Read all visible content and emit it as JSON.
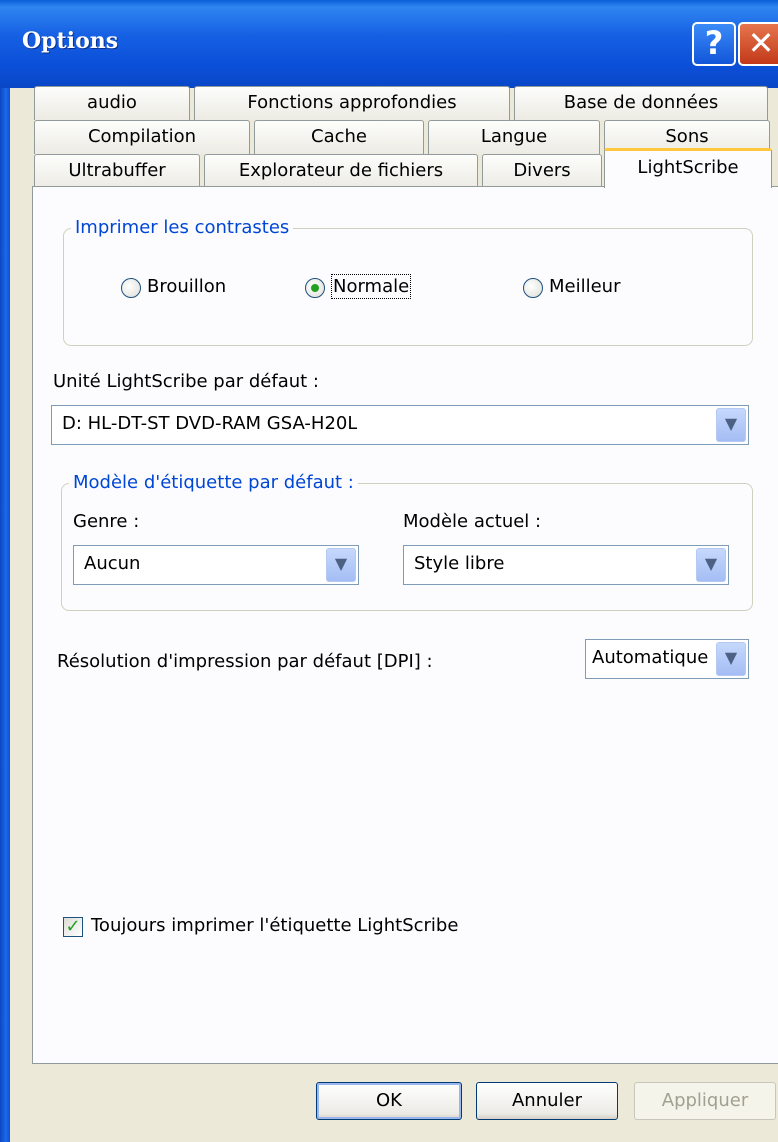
{
  "window": {
    "title": "Options"
  },
  "tabs": {
    "row1": [
      "audio",
      "Fonctions approfondies",
      "Base de données"
    ],
    "row2": [
      "Compilation",
      "Cache",
      "Langue",
      "Sons"
    ],
    "row3": [
      "Ultrabuffer",
      "Explorateur de fichiers",
      "Divers",
      "LightScribe"
    ],
    "active": "LightScribe"
  },
  "print_contrast": {
    "title": "Imprimer les contrastes",
    "options": [
      "Brouillon",
      "Normale",
      "Meilleur"
    ],
    "selected": "Normale"
  },
  "default_drive": {
    "label": "Unité LightScribe par défaut :",
    "value": "D: HL-DT-ST DVD-RAM GSA-H20L"
  },
  "label_template": {
    "title": "Modèle d'étiquette par défaut :",
    "genre_label": "Genre :",
    "genre_value": "Aucun",
    "model_label": "Modèle actuel :",
    "model_value": "Style libre"
  },
  "resolution": {
    "label": "Résolution d'impression par défaut [DPI] :",
    "value": "Automatique"
  },
  "always_print": {
    "label": "Toujours imprimer l'étiquette LightScribe",
    "checked": true
  },
  "buttons": {
    "ok": "OK",
    "cancel": "Annuler",
    "apply": "Appliquer"
  },
  "colors": {
    "titlebar": "#0b50d6",
    "group_title": "#0046d5",
    "active_tab_accent": "#ffc83c",
    "check": "#21a121"
  }
}
